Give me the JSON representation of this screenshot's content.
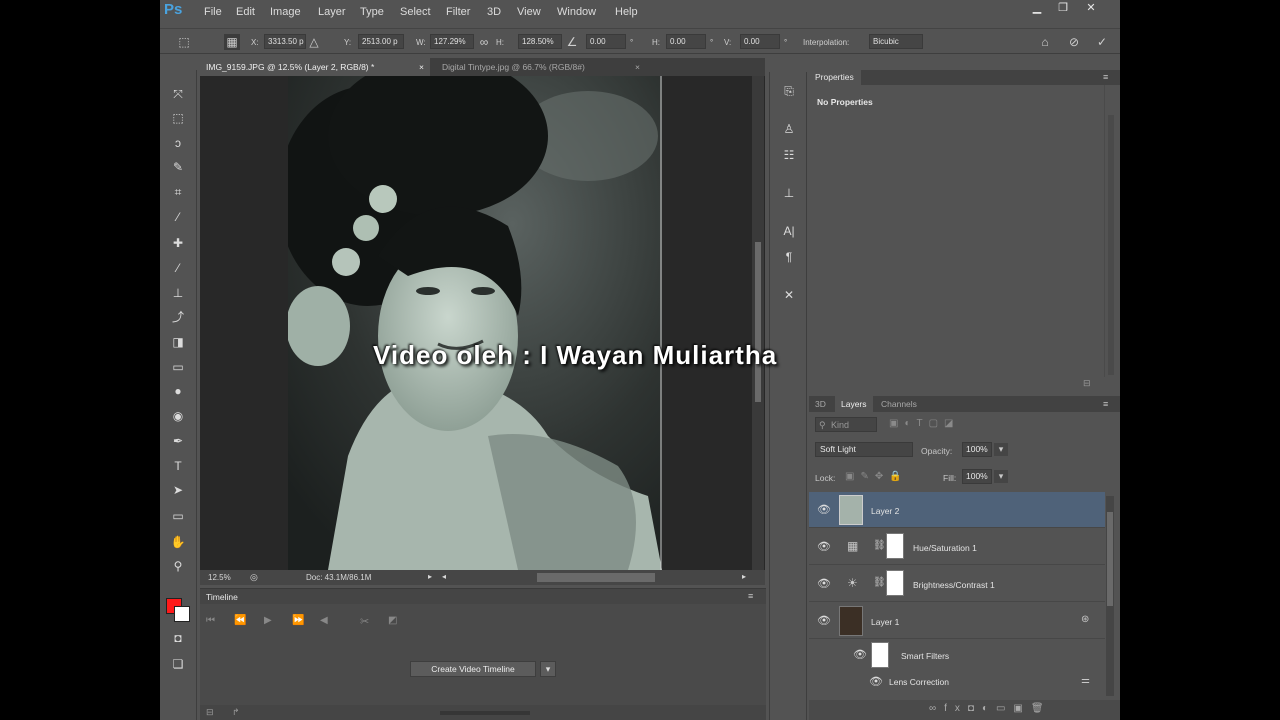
{
  "menubar": {
    "logo": "Ps",
    "items": [
      "File",
      "Edit",
      "Image",
      "Layer",
      "Type",
      "Select",
      "Filter",
      "3D",
      "View",
      "Window",
      "Help"
    ]
  },
  "optionsbar": {
    "x_label": "X:",
    "x_value": "3313.50 p",
    "y_label": "Y:",
    "y_value": "2513.00 p",
    "w_label": "W:",
    "w_value": "127.29%",
    "h_label": "H:",
    "h_value": "128.50%",
    "angle_value": "0.00",
    "hskew_label": "H:",
    "hskew_value": "0.00",
    "vskew_label": "V:",
    "vskew_value": "0.00",
    "interp_label": "Interpolation:",
    "interp_value": "Bicubic"
  },
  "doctabs": [
    {
      "label": "IMG_9159.JPG @ 12.5% (Layer 2, RGB/8) *",
      "close": "×"
    },
    {
      "label": "Digital Tintype.jpg @ 66.7% (RGB/8#)",
      "close": "×"
    }
  ],
  "statusbar": {
    "zoom": "12.5%",
    "doc": "Doc: 43.1M/86.1M"
  },
  "timeline": {
    "title": "Timeline",
    "create_button": "Create Video Timeline"
  },
  "properties": {
    "title": "Properties",
    "body": "No Properties"
  },
  "layers_panel": {
    "tabs": [
      "3D",
      "Layers",
      "Channels"
    ],
    "filter_kind": "Kind",
    "blend_mode": "Soft Light",
    "opacity_label": "Opacity:",
    "opacity_value": "100%",
    "lock_label": "Lock:",
    "fill_label": "Fill:",
    "fill_value": "100%",
    "rows": [
      {
        "name": "Layer 2"
      },
      {
        "name": "Hue/Saturation 1"
      },
      {
        "name": "Brightness/Contrast 1"
      },
      {
        "name": "Layer 1"
      },
      {
        "name": "Smart Filters"
      },
      {
        "name": "Lens Correction"
      }
    ]
  },
  "overlay": {
    "text": "Video oleh : I Wayan Muliartha"
  },
  "colors": {
    "foreground": "#ff1a1a",
    "background": "#ffffff",
    "selected_layer": "#4f6279",
    "ps_blue": "#4aa3df"
  }
}
